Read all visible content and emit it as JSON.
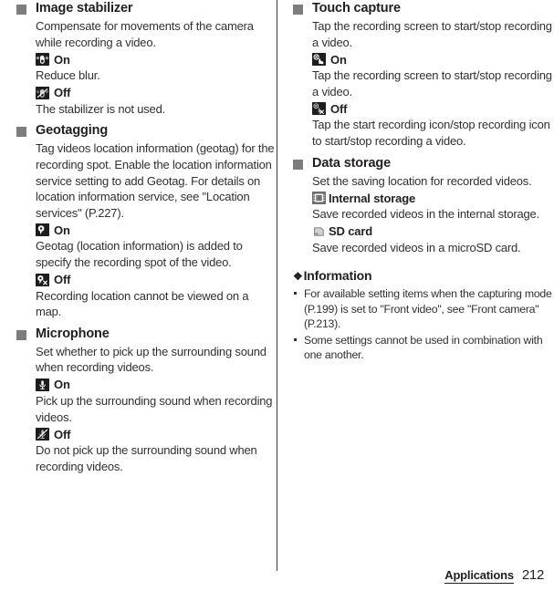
{
  "page": {
    "footer_section": "Applications",
    "footer_page": "212"
  },
  "left_column": {
    "sections": [
      {
        "title": "Image stabilizer",
        "description": "Compensate for movements of the camera while recording a video.",
        "options": [
          {
            "icon": "hand-stabilizer-on-icon",
            "label": "On",
            "description": "Reduce blur."
          },
          {
            "icon": "hand-stabilizer-off-icon",
            "label": "Off",
            "description": "The stabilizer is not used."
          }
        ]
      },
      {
        "title": "Geotagging",
        "description": "Tag videos location information (geotag) for the recording spot. Enable the location information service setting to add Geotag. For details on location information service, see \"Location services\" (P.227).",
        "options": [
          {
            "icon": "location-pin-on-icon",
            "label": "On",
            "description": "Geotag (location information) is added to specify the recording spot of the video."
          },
          {
            "icon": "location-pin-off-icon",
            "label": "Off",
            "description": "Recording location cannot be viewed on a map."
          }
        ]
      },
      {
        "title": "Microphone",
        "description": "Set whether to pick up the surrounding sound when recording videos.",
        "options": [
          {
            "icon": "microphone-on-icon",
            "label": "On",
            "description": "Pick up the surrounding sound when recording videos."
          },
          {
            "icon": "microphone-off-icon",
            "label": "Off",
            "description": "Do not pick up the surrounding sound when recording videos."
          }
        ]
      }
    ]
  },
  "right_column": {
    "sections": [
      {
        "title": "Touch capture",
        "description": "Tap the recording screen to start/stop recording a video.",
        "options": [
          {
            "icon": "touch-capture-on-icon",
            "label": "On",
            "description": "Tap the recording screen to start/stop recording a video."
          },
          {
            "icon": "touch-capture-off-icon",
            "label": "Off",
            "description": "Tap the start recording icon/stop recording icon to start/stop recording a video."
          }
        ]
      },
      {
        "title": "Data storage",
        "description": "Set the saving location for recorded videos.",
        "options": [
          {
            "icon": "internal-storage-chip-icon",
            "label": "Internal storage",
            "description": "Save recorded videos in the internal storage."
          },
          {
            "icon": "sd-card-icon",
            "label": "SD card",
            "description": "Save recorded videos in a microSD card."
          }
        ]
      }
    ],
    "information": {
      "diamond": "❖",
      "title": "Information",
      "items": [
        "For available setting items when the capturing mode (P.199) is set to \"Front video\", see \"Front camera\" (P.213).",
        "Some settings cannot be used in combination with one another."
      ]
    }
  },
  "colors": {
    "bullet_gray": "#7d7d7d",
    "icon_dark": "#1d1d1d",
    "text": "#231f20",
    "divider": "#3a3a3a"
  }
}
